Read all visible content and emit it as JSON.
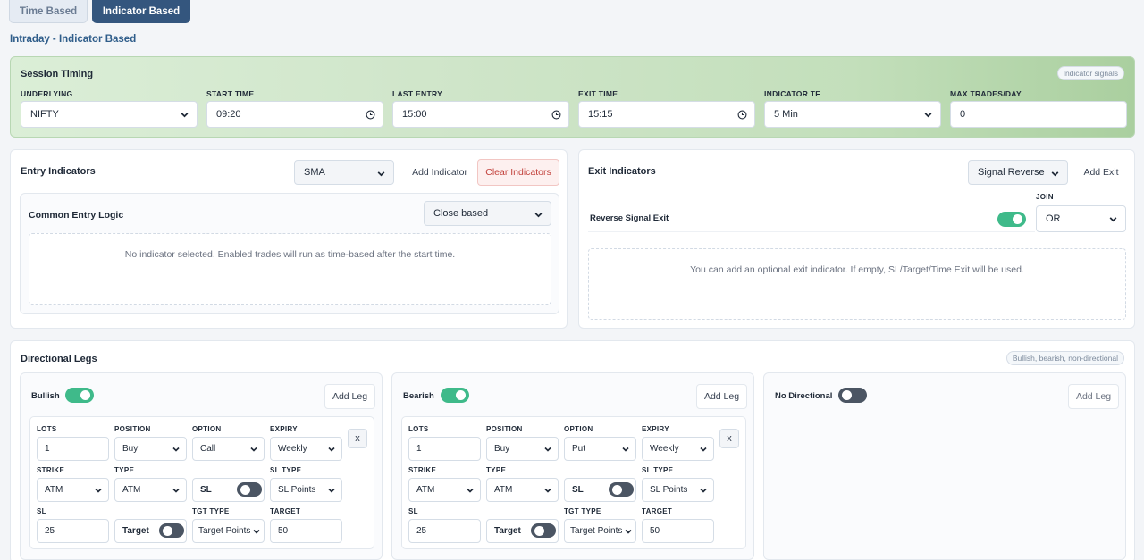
{
  "tabs": [
    {
      "label": "Time Based",
      "active": false
    },
    {
      "label": "Indicator Based",
      "active": true
    }
  ],
  "page_title": "Intraday - Indicator Based",
  "session": {
    "title": "Session Timing",
    "badge": "Indicator signals",
    "fields": [
      {
        "label": "UNDERLYING",
        "value": "NIFTY",
        "kind": "select"
      },
      {
        "label": "START TIME",
        "value": "09:20",
        "kind": "time"
      },
      {
        "label": "LAST ENTRY",
        "value": "15:00",
        "kind": "time"
      },
      {
        "label": "EXIT TIME",
        "value": "15:15",
        "kind": "time"
      },
      {
        "label": "INDICATOR TF",
        "value": "5 Min",
        "kind": "select"
      },
      {
        "label": "MAX TRADES/DAY",
        "value": "0",
        "kind": "input"
      }
    ]
  },
  "entry": {
    "title": "Entry Indicators",
    "indicator_select": "SMA",
    "add_label": "Add Indicator",
    "clear_label": "Clear Indicators",
    "logic_title": "Common Entry Logic",
    "logic_select": "Close based",
    "empty_text": "No indicator selected. Enabled trades will run as time-based after the start time."
  },
  "exit": {
    "title": "Exit Indicators",
    "select": "Signal Reverse",
    "add_label": "Add Exit",
    "join_label": "JOIN",
    "row_label": "Reverse Signal Exit",
    "row_toggle_on": true,
    "join_value": "OR",
    "empty_text": "You can add an optional exit indicator. If empty, SL/Target/Time Exit will be used."
  },
  "legs": {
    "title": "Directional Legs",
    "badge": "Bullish, bearish, non-directional",
    "columns": [
      {
        "name": "Bullish",
        "enabled": true,
        "add_label": "Add Leg",
        "leg": {
          "labels": {
            "lots": "LOTS",
            "position": "POSITION",
            "option": "OPTION",
            "expiry": "EXPIRY",
            "strike": "STRIKE",
            "type": "TYPE",
            "sl_type": "SL TYPE",
            "sl": "SL",
            "tgt_type": "TGT TYPE",
            "target": "TARGET"
          },
          "lots": "1",
          "position": "Buy",
          "option": "Call",
          "expiry": "Weekly",
          "strike": "ATM",
          "type": "ATM",
          "sl_toggle_label": "SL",
          "sl_toggle_on": false,
          "sl_type": "SL Points",
          "sl": "25",
          "target_toggle_label": "Target",
          "target_toggle_on": false,
          "tgt_type": "Target Points",
          "target": "50",
          "remove_label": "x"
        }
      },
      {
        "name": "Bearish",
        "enabled": true,
        "add_label": "Add Leg",
        "leg": {
          "labels": {
            "lots": "LOTS",
            "position": "POSITION",
            "option": "OPTION",
            "expiry": "EXPIRY",
            "strike": "STRIKE",
            "type": "TYPE",
            "sl_type": "SL TYPE",
            "sl": "SL",
            "tgt_type": "TGT TYPE",
            "target": "TARGET"
          },
          "lots": "1",
          "position": "Buy",
          "option": "Put",
          "expiry": "Weekly",
          "strike": "ATM",
          "type": "ATM",
          "sl_toggle_label": "SL",
          "sl_toggle_on": false,
          "sl_type": "SL Points",
          "sl": "25",
          "target_toggle_label": "Target",
          "target_toggle_on": false,
          "tgt_type": "Target Points",
          "target": "50",
          "remove_label": "x"
        }
      },
      {
        "name": "No Directional",
        "enabled": false,
        "add_label": "Add Leg"
      }
    ]
  },
  "colors": {
    "accent": "#34567e",
    "toggle_on": "#3fba8a",
    "toggle_off": "#4b5563",
    "danger": "#c2413b",
    "session_bg": "#cfe5c9"
  }
}
